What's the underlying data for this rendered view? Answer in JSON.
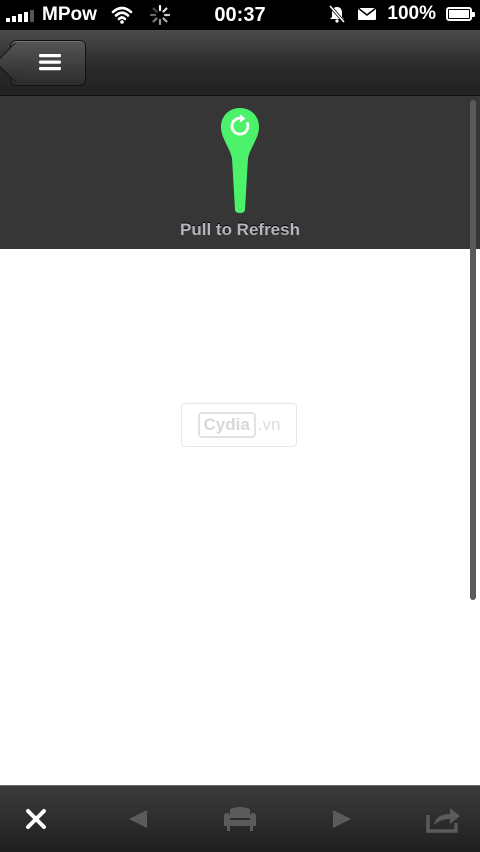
{
  "status_bar": {
    "carrier": "MPow",
    "time": "00:37",
    "battery": "100%"
  },
  "nav": {
    "menu_icon": "hamburger-icon"
  },
  "pull_to_refresh": {
    "label": "Pull to Refresh",
    "accent_color": "#4cf26a"
  },
  "watermark": {
    "boxed": "Cydia",
    "suffix": ".vn"
  },
  "toolbar": {
    "close_icon": "close-icon",
    "back_icon": "back-arrow-icon",
    "reader_icon": "armchair-icon",
    "forward_icon": "forward-arrow-icon",
    "share_icon": "share-icon"
  }
}
